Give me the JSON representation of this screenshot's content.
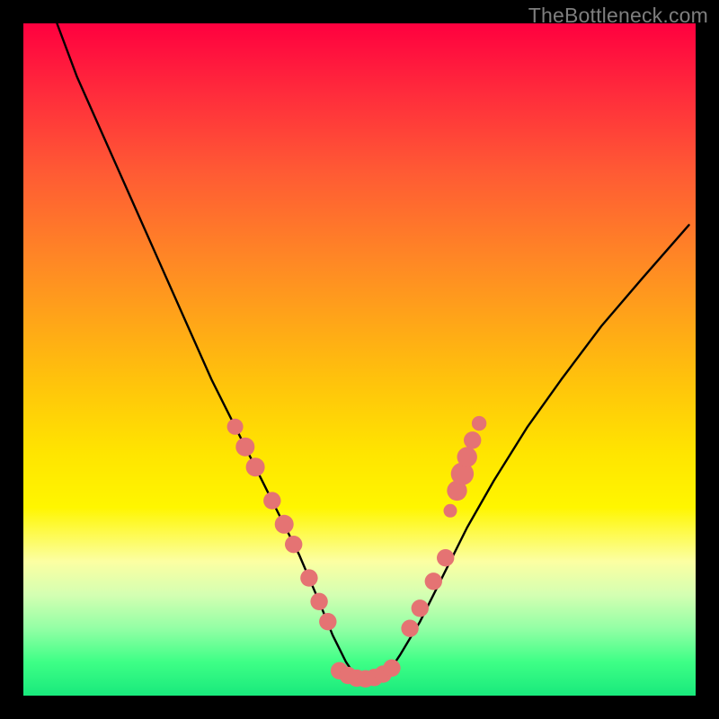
{
  "watermark": "TheBottleneck.com",
  "chart_data": {
    "type": "line",
    "title": "",
    "xlabel": "",
    "ylabel": "",
    "xlim": [
      0,
      100
    ],
    "ylim": [
      0,
      100
    ],
    "curve": {
      "name": "bottleneck-curve",
      "x": [
        5,
        8,
        12,
        16,
        20,
        24,
        28,
        32,
        35,
        38,
        41,
        44,
        46,
        48,
        50,
        52,
        54,
        56,
        59,
        62,
        66,
        70,
        75,
        80,
        86,
        92,
        99
      ],
      "y": [
        100,
        92,
        83,
        74,
        65,
        56,
        47,
        39,
        33,
        27,
        21,
        14,
        9,
        5,
        2,
        2,
        3,
        6,
        11,
        17,
        25,
        32,
        40,
        47,
        55,
        62,
        70
      ]
    },
    "markers_left": {
      "name": "markers-left-branch",
      "points": [
        {
          "x": 31.5,
          "y": 40,
          "r": 1.2
        },
        {
          "x": 33.0,
          "y": 37,
          "r": 1.4
        },
        {
          "x": 34.5,
          "y": 34,
          "r": 1.4
        },
        {
          "x": 37.0,
          "y": 29,
          "r": 1.3
        },
        {
          "x": 38.8,
          "y": 25.5,
          "r": 1.4
        },
        {
          "x": 40.2,
          "y": 22.5,
          "r": 1.3
        },
        {
          "x": 42.5,
          "y": 17.5,
          "r": 1.3
        },
        {
          "x": 44.0,
          "y": 14.0,
          "r": 1.3
        },
        {
          "x": 45.3,
          "y": 11.0,
          "r": 1.3
        }
      ]
    },
    "markers_bottom": {
      "name": "markers-minimum",
      "points": [
        {
          "x": 47.0,
          "y": 3.7,
          "r": 1.3
        },
        {
          "x": 48.3,
          "y": 3.0,
          "r": 1.3
        },
        {
          "x": 49.6,
          "y": 2.6,
          "r": 1.3
        },
        {
          "x": 50.9,
          "y": 2.5,
          "r": 1.3
        },
        {
          "x": 52.2,
          "y": 2.7,
          "r": 1.3
        },
        {
          "x": 53.5,
          "y": 3.2,
          "r": 1.3
        },
        {
          "x": 54.8,
          "y": 4.1,
          "r": 1.3
        }
      ]
    },
    "markers_right": {
      "name": "markers-right-branch",
      "points": [
        {
          "x": 57.5,
          "y": 10.0,
          "r": 1.3
        },
        {
          "x": 59.0,
          "y": 13.0,
          "r": 1.3
        },
        {
          "x": 61.0,
          "y": 17.0,
          "r": 1.3
        },
        {
          "x": 62.8,
          "y": 20.5,
          "r": 1.3
        },
        {
          "x": 63.5,
          "y": 27.5,
          "r": 1.0
        },
        {
          "x": 64.5,
          "y": 30.5,
          "r": 1.5
        },
        {
          "x": 65.3,
          "y": 33.0,
          "r": 1.7
        },
        {
          "x": 66.0,
          "y": 35.5,
          "r": 1.5
        },
        {
          "x": 66.8,
          "y": 38.0,
          "r": 1.3
        },
        {
          "x": 67.8,
          "y": 40.5,
          "r": 1.1
        }
      ]
    }
  }
}
